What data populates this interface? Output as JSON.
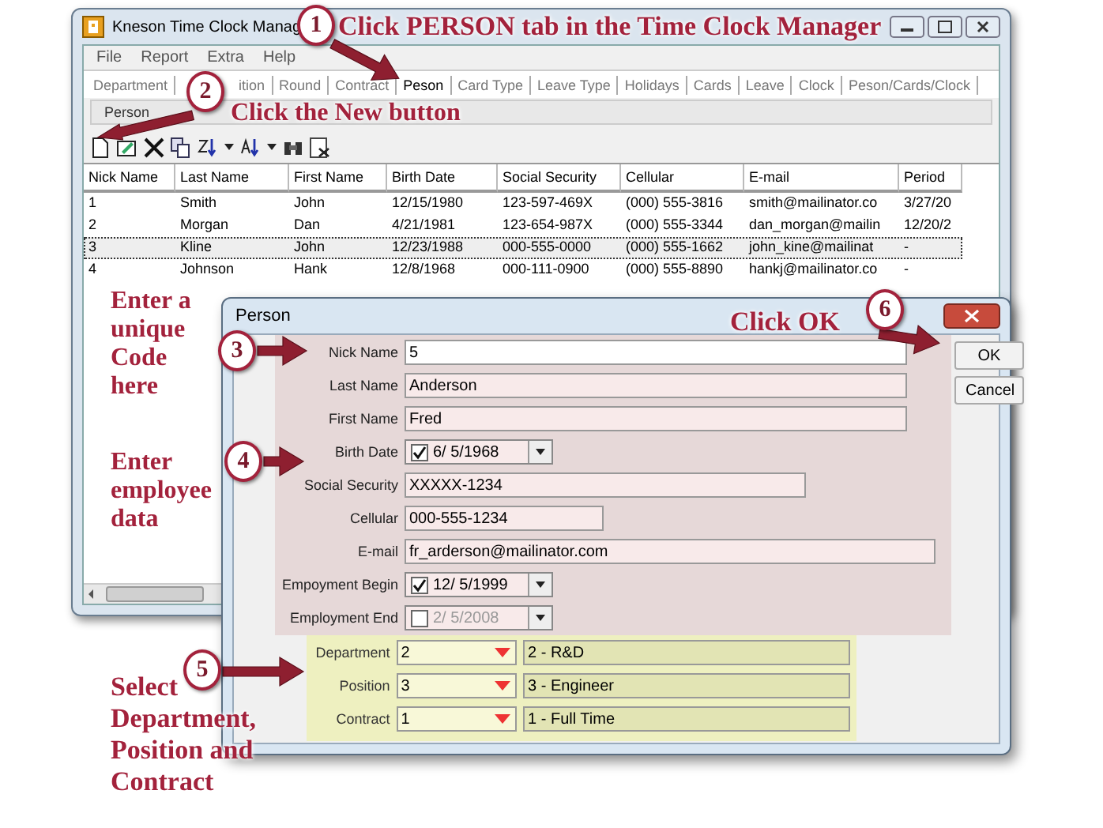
{
  "window": {
    "title": "Kneson Time Clock Manag"
  },
  "menu": [
    "File",
    "Report",
    "Extra",
    "Help"
  ],
  "tabs": [
    {
      "label": "Department",
      "selected": false
    },
    {
      "label": "ition",
      "selected": false
    },
    {
      "label": "Round",
      "selected": false
    },
    {
      "label": "Contract",
      "selected": false
    },
    {
      "label": "Peson",
      "selected": true
    },
    {
      "label": "Card Type",
      "selected": false
    },
    {
      "label": "Leave Type",
      "selected": false
    },
    {
      "label": "Holidays",
      "selected": false
    },
    {
      "label": "Cards",
      "selected": false
    },
    {
      "label": "Leave",
      "selected": false
    },
    {
      "label": "Clock",
      "selected": false
    },
    {
      "label": "Peson/Cards/Clock",
      "selected": false
    }
  ],
  "subtabs": [
    {
      "label": "Person",
      "selected": true
    }
  ],
  "table": {
    "columns": [
      "Nick Name",
      "Last Name",
      "First Name",
      "Birth Date",
      "Social Security",
      "Cellular",
      "E-mail",
      "Period"
    ],
    "rows": [
      {
        "selected": false,
        "cells": [
          "1",
          "Smith",
          "John",
          "12/15/1980",
          "123-597-469X",
          "(000) 555-3816",
          "smith@mailinator.co",
          "3/27/20"
        ]
      },
      {
        "selected": false,
        "cells": [
          "2",
          "Morgan",
          "Dan",
          "4/21/1981",
          "123-654-987X",
          "(000) 555-3344",
          "dan_morgan@mailin",
          "12/20/2"
        ]
      },
      {
        "selected": true,
        "cells": [
          "3",
          "Kline",
          "John",
          "12/23/1988",
          "000-555-0000",
          "(000) 555-1662",
          "john_kine@mailinat",
          "-"
        ]
      },
      {
        "selected": false,
        "cells": [
          "4",
          "Johnson",
          "Hank",
          "12/8/1968",
          "000-111-0900",
          "(000) 555-8890",
          "hankj@mailinator.co",
          "-"
        ]
      }
    ]
  },
  "dialog": {
    "title": "Person",
    "fields": [
      {
        "kind": "text",
        "label": "Nick Name",
        "value": "5",
        "focused": true
      },
      {
        "kind": "text",
        "label": "Last Name",
        "value": "Anderson",
        "focused": false
      },
      {
        "kind": "text",
        "label": "First Name",
        "value": "Fred",
        "focused": false
      },
      {
        "kind": "date",
        "label": "Birth Date",
        "value": "6/ 5/1968",
        "checked": true
      },
      {
        "kind": "text",
        "label": "Social Security",
        "value": "XXXXX-1234",
        "focused": false
      },
      {
        "kind": "text",
        "label": "Cellular",
        "value": "000-555-1234",
        "focused": false
      },
      {
        "kind": "text",
        "label": "E-mail",
        "value": "fr_arderson@mailinator.com",
        "focused": false
      },
      {
        "kind": "date",
        "label": "Empoyment Begin",
        "value": "12/ 5/1999",
        "checked": true
      },
      {
        "kind": "date",
        "label": "Employment End",
        "value": "2/ 5/2008",
        "checked": false
      }
    ],
    "lookups": [
      {
        "label": "Department",
        "value": "2",
        "description": "2 - R&D"
      },
      {
        "label": "Position",
        "value": "3",
        "description": "3 - Engineer"
      },
      {
        "label": "Contract",
        "value": "1",
        "description": "1 - Full Time"
      }
    ],
    "buttons": [
      "OK",
      "Cancel"
    ]
  },
  "annotations": [
    {
      "number": "1",
      "text": "Click PERSON tab in the Time Clock Manager"
    },
    {
      "number": "2",
      "text": "Click the New button"
    },
    {
      "number": "3",
      "text": "Enter a unique Code here"
    },
    {
      "number": "4",
      "text": "Enter employee data"
    },
    {
      "number": "5",
      "text": "Select Department, Position and Contract"
    },
    {
      "number": "6",
      "text": "Click OK"
    }
  ]
}
